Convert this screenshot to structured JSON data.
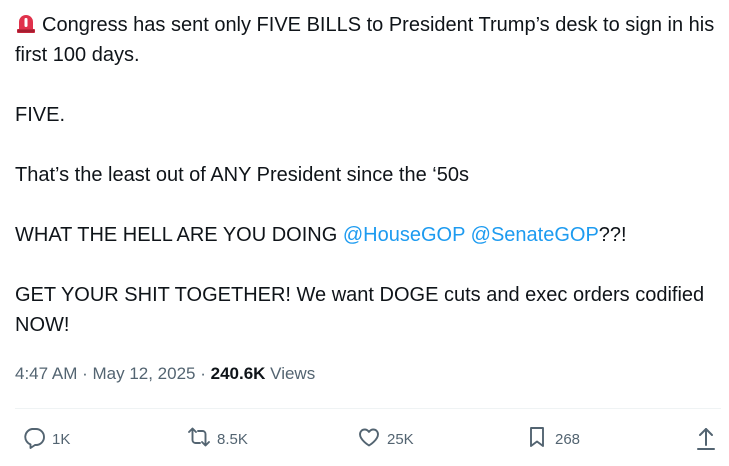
{
  "tweet": {
    "line1_text": "Congress has sent only FIVE BILLS to President Trump’s desk to sign in his first 100 days.",
    "line2_text": "FIVE.",
    "line3_text": "That’s the least out of ANY President since the ‘50s",
    "line4_prefix": "WHAT THE HELL ARE YOU DOING ",
    "mention1": "@HouseGOP",
    "mention2": "@SenateGOP",
    "line4_suffix": "??!",
    "line5_text": "GET YOUR SHIT TOGETHER! We want DOGE cuts and exec orders codified NOW!",
    "emoji": "siren-icon",
    "mention_color": "#1d9bf0"
  },
  "meta": {
    "time": "4:47 AM",
    "separator": " · ",
    "date": "May 12, 2025",
    "views_count": "240.6K",
    "views_label": " Views"
  },
  "actions": {
    "replies": {
      "icon": "reply-icon",
      "count": "1K"
    },
    "reposts": {
      "icon": "repost-icon",
      "count": "8.5K"
    },
    "likes": {
      "icon": "like-icon",
      "count": "25K"
    },
    "bookmarks": {
      "icon": "bookmark-icon",
      "count": "268"
    },
    "share": {
      "icon": "share-icon"
    }
  }
}
